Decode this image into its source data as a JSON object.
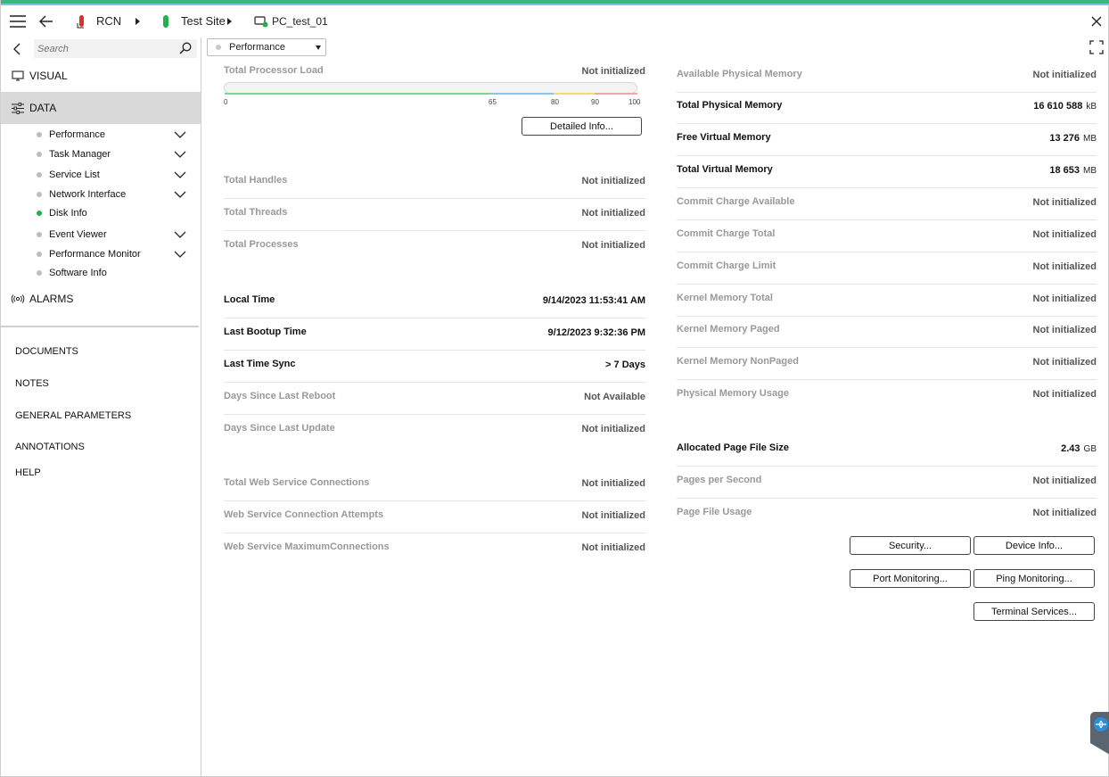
{
  "header": {
    "crumbs": [
      {
        "label": "RCN"
      },
      {
        "label": "Test Site"
      },
      {
        "label": "PC_test_01"
      }
    ]
  },
  "colors": {
    "accent_green": "#3cb878",
    "accent_blue": "#70c9e6",
    "active_nav_bg": "#d9d9d9",
    "status_green": "#22b24c",
    "rcn_red": "#d9342b"
  },
  "sidebar": {
    "search_placeholder": "Search",
    "visual_label": "VISUAL",
    "data_label": "DATA",
    "alarms_label": "ALARMS",
    "sub_items": [
      {
        "label": "Performance",
        "expandable": true,
        "status": "grey"
      },
      {
        "label": "Task Manager",
        "expandable": true,
        "status": "grey"
      },
      {
        "label": "Service List",
        "expandable": true,
        "status": "grey"
      },
      {
        "label": "Network Interface",
        "expandable": true,
        "status": "grey"
      },
      {
        "label": "Disk Info",
        "expandable": false,
        "status": "green"
      },
      {
        "label": "Event Viewer",
        "expandable": true,
        "status": "grey"
      },
      {
        "label": "Performance Monitor",
        "expandable": true,
        "status": "grey"
      },
      {
        "label": "Software Info",
        "expandable": false,
        "status": "grey"
      }
    ],
    "lower_items": [
      "DOCUMENTS",
      "NOTES",
      "GENERAL PARAMETERS",
      "ANNOTATIONS",
      "HELP"
    ]
  },
  "page_select": {
    "value": "Performance"
  },
  "processor": {
    "label": "Total Processor Load",
    "value": "Not initialized",
    "load_fraction": 0,
    "ticks": [
      "0",
      "65",
      "80",
      "90",
      "100"
    ],
    "detailed_button": "Detailed Info..."
  },
  "left_group1": [
    {
      "label": "Total Handles",
      "value": "Not initialized"
    },
    {
      "label": "Total Threads",
      "value": "Not initialized"
    },
    {
      "label": "Total Processes",
      "value": "Not initialized"
    }
  ],
  "left_group2": [
    {
      "label": "Local Time",
      "value": "9/14/2023 11:53:41 AM"
    },
    {
      "label": "Last Bootup Time",
      "value": "9/12/2023 9:32:36 PM"
    },
    {
      "label": "Last Time Sync",
      "value": "> 7 Days"
    },
    {
      "label": "Days Since Last Reboot",
      "value": "Not Available"
    },
    {
      "label": "Days Since Last Update",
      "value": "Not initialized"
    }
  ],
  "left_group3": [
    {
      "label": "Total Web Service Connections",
      "value": "Not initialized"
    },
    {
      "label": "Web Service Connection Attempts",
      "value": "Not initialized"
    },
    {
      "label": "Web Service MaximumConnections",
      "value": "Not initialized"
    }
  ],
  "right_group1": [
    {
      "label": "Available Physical Memory",
      "value": "Not initialized",
      "unit": ""
    },
    {
      "label": "Total Physical Memory",
      "value": "16 610 588",
      "unit": "kB"
    },
    {
      "label": "Free Virtual Memory",
      "value": "13 276",
      "unit": "MB"
    },
    {
      "label": "Total Virtual Memory",
      "value": "18 653",
      "unit": "MB"
    },
    {
      "label": "Commit Charge Available",
      "value": "Not initialized",
      "unit": ""
    },
    {
      "label": "Commit Charge Total",
      "value": "Not initialized",
      "unit": ""
    },
    {
      "label": "Commit Charge Limit",
      "value": "Not initialized",
      "unit": ""
    },
    {
      "label": "Kernel Memory Total",
      "value": "Not initialized",
      "unit": ""
    },
    {
      "label": "Kernel Memory Paged",
      "value": "Not initialized",
      "unit": ""
    },
    {
      "label": "Kernel Memory NonPaged",
      "value": "Not initialized",
      "unit": ""
    },
    {
      "label": "Physical Memory Usage",
      "value": "Not initialized",
      "unit": ""
    }
  ],
  "right_group2": [
    {
      "label": "Allocated Page File Size",
      "value": "2.43",
      "unit": "GB"
    },
    {
      "label": "Pages per Second",
      "value": "Not initialized",
      "unit": ""
    },
    {
      "label": "Page File Usage",
      "value": "Not initialized",
      "unit": ""
    }
  ],
  "buttons": {
    "security": "Security...",
    "device_info": "Device Info...",
    "port_monitoring": "Port Monitoring...",
    "ping_monitoring": "Ping Monitoring...",
    "terminal_services": "Terminal Services..."
  }
}
